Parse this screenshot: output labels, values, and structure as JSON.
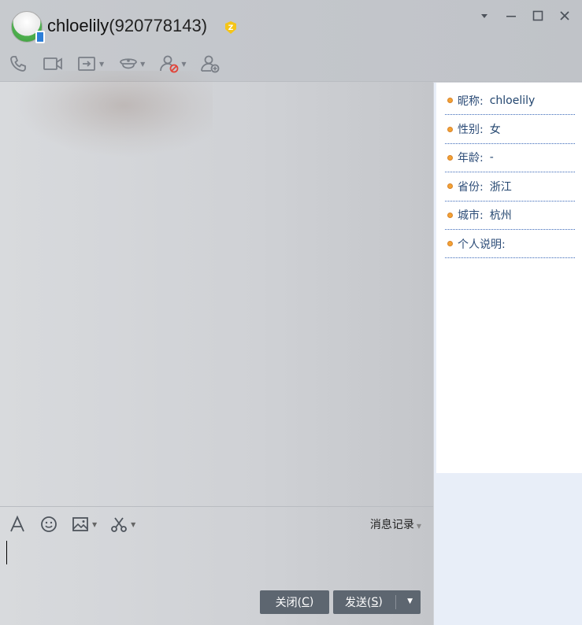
{
  "window": {
    "title_name": "chloelily",
    "title_id": "(920778143)",
    "controls": [
      "▾",
      "—",
      "□",
      "✕"
    ]
  },
  "toolbar": {
    "items": [
      {
        "icon": "phone-icon"
      },
      {
        "icon": "video-icon"
      },
      {
        "icon": "share-screen-icon",
        "dropdown": true
      },
      {
        "icon": "remote-assist-icon",
        "dropdown": true
      },
      {
        "icon": "block-user-icon",
        "dropdown": true
      },
      {
        "icon": "add-friend-icon"
      }
    ]
  },
  "input_toolbar": {
    "history_label": "消息记录"
  },
  "buttons": {
    "close_label": "关闭(",
    "close_key": "C",
    "close_end": ")",
    "send_label": "发送(",
    "send_key": "S",
    "send_end": ")"
  },
  "profile": {
    "items": [
      {
        "key": "昵称:",
        "value": "chloelily"
      },
      {
        "key": "性别:",
        "value": "女"
      },
      {
        "key": "年龄:",
        "value": " -"
      },
      {
        "key": "省份:",
        "value": "浙江"
      },
      {
        "key": "城市:",
        "value": "杭州"
      },
      {
        "key": "个人说明:",
        "value": ""
      }
    ]
  },
  "colors": {
    "accent_bullet": "#f4a233",
    "button_bg": "#5d6670",
    "sidebar_bg": "#e8eef8"
  }
}
